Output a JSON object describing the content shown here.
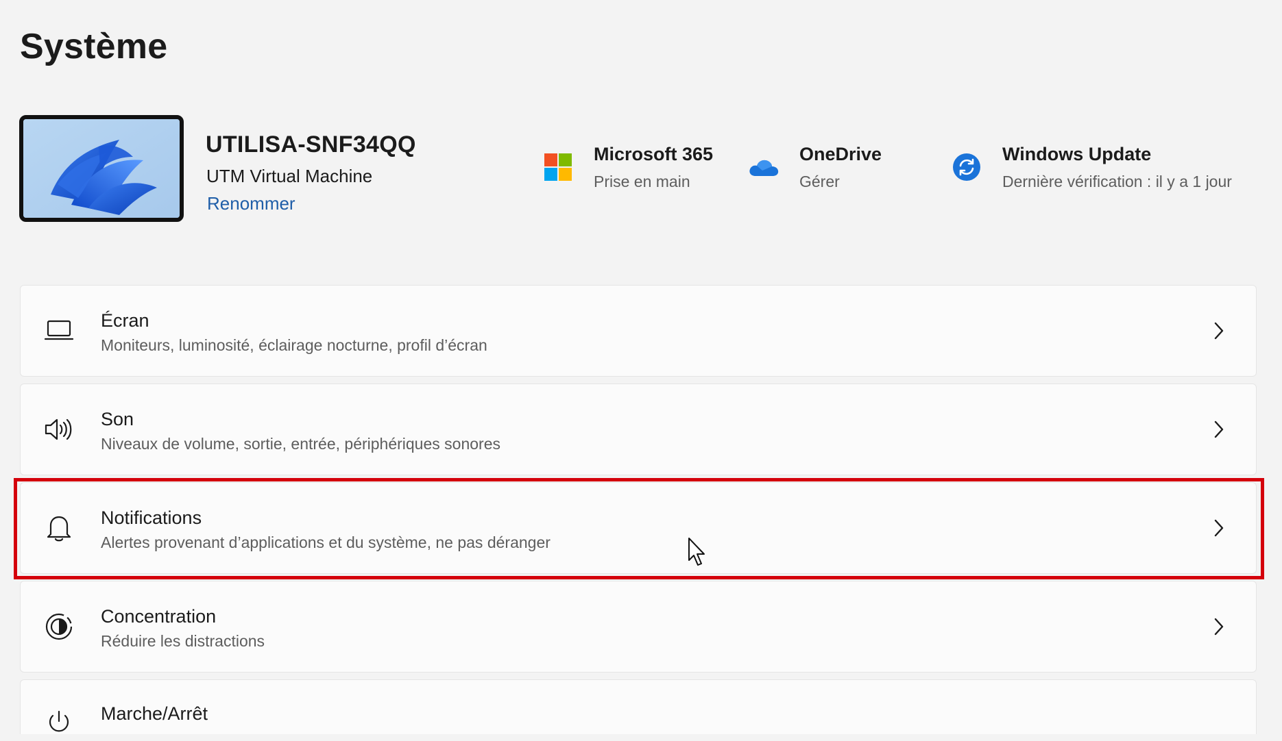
{
  "page": {
    "title": "Système"
  },
  "device": {
    "name": "UTILISA-SNF34QQ",
    "model": "UTM Virtual Machine",
    "rename_label": "Renommer"
  },
  "quick_links": [
    {
      "title": "Microsoft 365",
      "subtitle": "Prise en main",
      "icon": "microsoft-logo-icon"
    },
    {
      "title": "OneDrive",
      "subtitle": "Gérer",
      "icon": "onedrive-cloud-icon"
    },
    {
      "title": "Windows Update",
      "subtitle": "Dernière vérification : il y a 1 jour",
      "icon": "windows-update-icon"
    }
  ],
  "settings": [
    {
      "title": "Écran",
      "description": "Moniteurs, luminosité, éclairage nocturne, profil d’écran",
      "icon": "display-icon"
    },
    {
      "title": "Son",
      "description": "Niveaux de volume, sortie, entrée, périphériques sonores",
      "icon": "speaker-icon"
    },
    {
      "title": "Notifications",
      "description": "Alertes provenant d’applications et du système, ne pas déranger",
      "icon": "bell-icon",
      "highlighted": true
    },
    {
      "title": "Concentration",
      "description": "Réduire les distractions",
      "icon": "focus-icon"
    },
    {
      "title": "Marche/Arrêt",
      "description": "",
      "icon": "power-icon"
    }
  ],
  "colors": {
    "background": "#f3f3f3",
    "card": "#fbfbfb",
    "accent_link": "#1f5ea8",
    "highlight": "#d4000b"
  }
}
